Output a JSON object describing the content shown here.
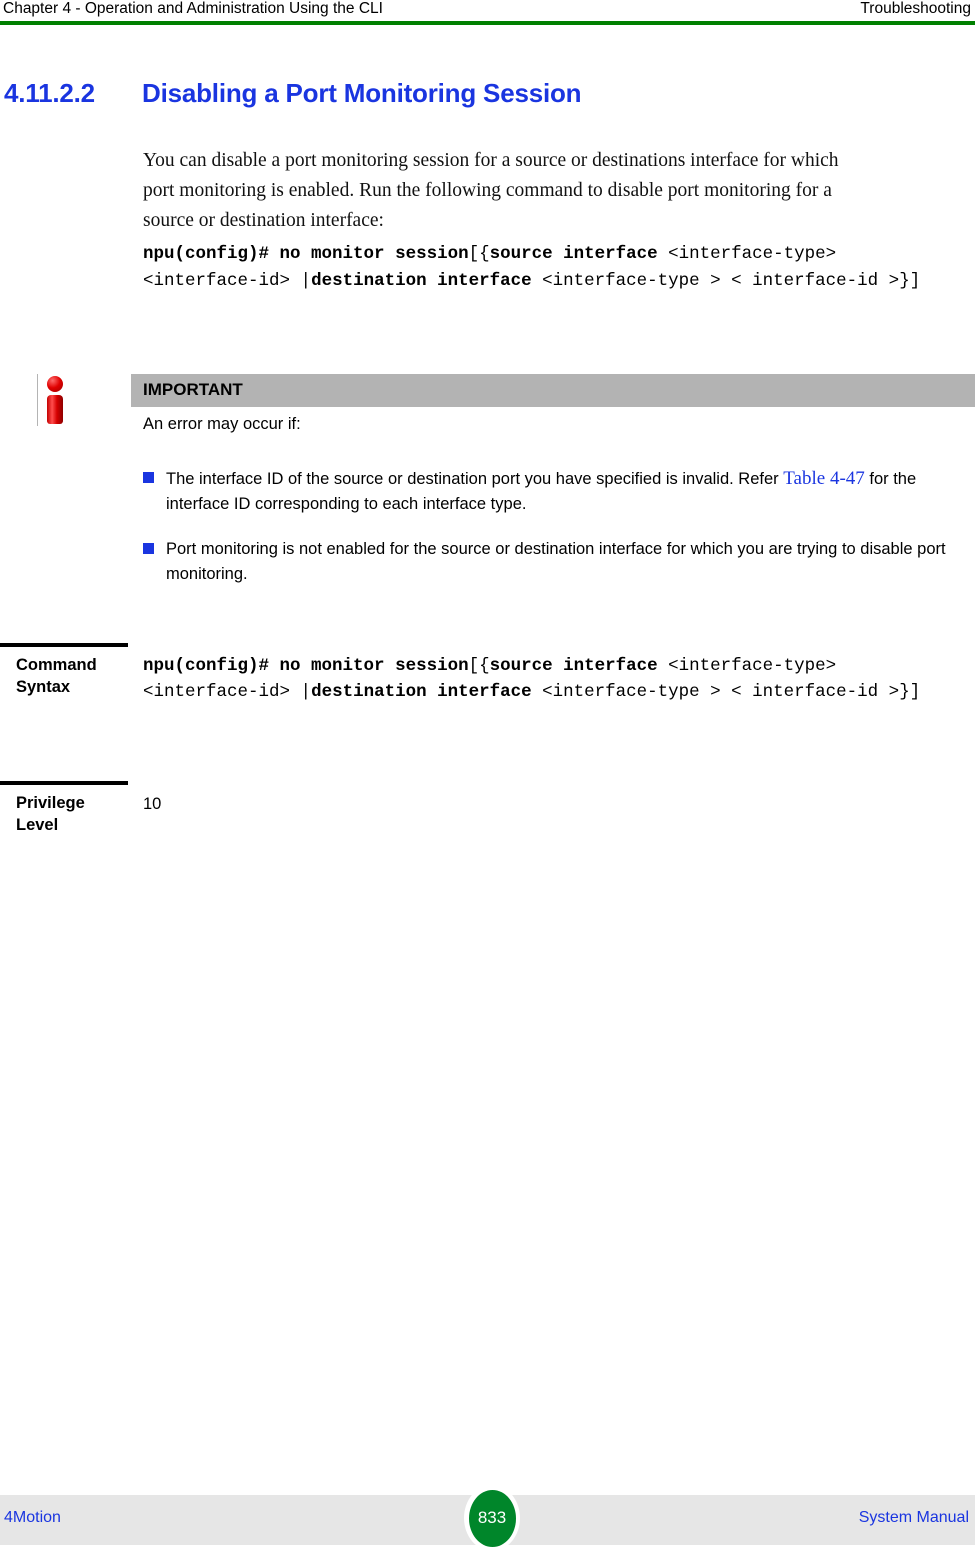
{
  "header": {
    "left": "Chapter 4 - Operation and Administration Using the CLI",
    "right": "Troubleshooting",
    "rule_color": "#008000"
  },
  "heading": {
    "number": "4.11.2.2",
    "title": "Disabling a Port Monitoring Session",
    "color": "#1a35e0"
  },
  "body": {
    "paragraph": "You can disable a port monitoring session for a source or destinations interface for which port monitoring is enabled. Run the following command to disable port monitoring for a source or destination interface:"
  },
  "command_inline": {
    "prompt": "npu(config)#",
    "keyword_1": "no monitor session",
    "open": "[{",
    "keyword_2": "source interface",
    "arg_1": "<interface-type> <interface-id>",
    "pipe": "|",
    "keyword_3": "destination interface",
    "arg_2": "<interface-type > < interface-id >",
    "close": "}]",
    "full_text": "npu(config)# no monitor session [{source interface <interface-type> <interface-id> |destination interface <interface-type > < interface-id >}]"
  },
  "callout": {
    "icon": "info-important-icon",
    "title": "IMPORTANT",
    "title_bar_color": "#b3b3b3",
    "intro": "An error may occur if:",
    "bullet_color": "#1a35e0",
    "bullets": [
      {
        "text_before": "The interface ID of the source or destination port you have specified is invalid. Refer",
        "link": "Table 4-47",
        "text_after": "for the interface ID corresponding to each interface type."
      },
      {
        "text_before": "Port monitoring is not enabled for the source or destination interface for which you are trying to disable port monitoring.",
        "link": "",
        "text_after": ""
      }
    ]
  },
  "definitions": [
    {
      "label": "Command Syntax",
      "label_line_1": "Command",
      "label_line_2": "Syntax",
      "value": "npu(config)# no monitor session [{source interface <interface-type> <interface-id> |destination interface <interface-type > < interface-id >}]"
    },
    {
      "label": "Privilege Level",
      "label_line_1": "Privilege",
      "label_line_2": "Level",
      "value": "10"
    }
  ],
  "footer": {
    "left": "4Motion",
    "page_number": "833",
    "right": "System Manual",
    "band_color": "#e6e6e6",
    "badge_color": "#00862a",
    "link_color": "#1a35e0"
  }
}
